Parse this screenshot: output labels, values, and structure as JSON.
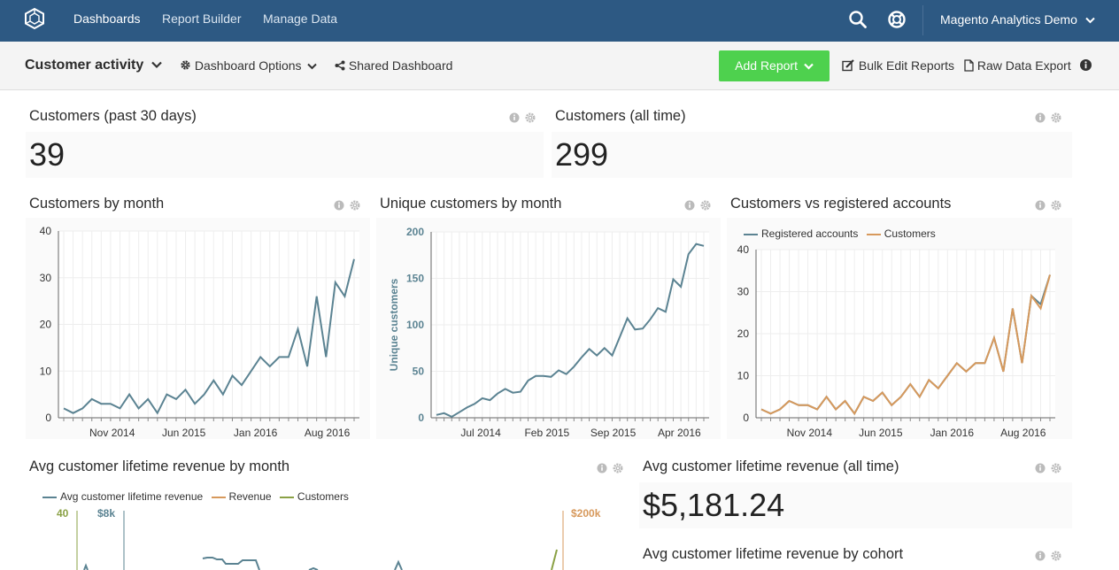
{
  "topnav": {
    "logo": "hexagon-logo-icon",
    "links": [
      "Dashboards",
      "Report Builder",
      "Manage Data"
    ],
    "account": "Magento Analytics Demo"
  },
  "toolbar": {
    "dashboard_name": "Customer activity",
    "dashboard_options": "Dashboard Options",
    "shared_dashboard": "Shared Dashboard",
    "add_report": "Add Report",
    "bulk_edit": "Bulk Edit Reports",
    "raw_export": "Raw Data Export"
  },
  "cards": {
    "c30": {
      "title": "Customers (past 30 days)",
      "value": "39"
    },
    "call": {
      "title": "Customers (all time)",
      "value": "299"
    },
    "cbm": {
      "title": "Customers by month"
    },
    "ucbm": {
      "title": "Unique customers by month"
    },
    "cvr": {
      "title": "Customers vs registered accounts"
    },
    "acltv": {
      "title": "Avg customer lifetime revenue by month"
    },
    "acltv_all": {
      "title": "Avg customer lifetime revenue (all time)",
      "value": "$5,181.24"
    },
    "acltv_cohort": {
      "title": "Avg customer lifetime revenue by cohort"
    }
  },
  "colors": {
    "nav": "#2d5983",
    "add_report": "#4ed14e",
    "series_blue": "#5b8392",
    "series_orange": "#d7995c",
    "series_green": "#8aa145"
  },
  "chart_data": [
    {
      "type": "line",
      "title": "Customers by month",
      "ylim": [
        0,
        40
      ],
      "yticks": [
        "0",
        "10",
        "20",
        "30",
        "40"
      ],
      "xticks": [
        "Nov 2014",
        "Jun 2015",
        "Jan 2016",
        "Aug 2016"
      ],
      "series": [
        {
          "values": [
            2,
            1,
            2,
            4,
            3,
            3,
            2,
            5,
            2,
            4,
            1,
            5,
            4,
            6,
            3,
            5,
            8,
            5,
            9,
            7,
            10,
            13,
            11,
            13,
            13,
            19,
            11,
            26,
            13,
            29,
            26,
            34
          ]
        }
      ],
      "grid": true
    },
    {
      "type": "line",
      "title": "Unique customers by month",
      "ylabel": "Unique customers",
      "ylim": [
        0,
        200
      ],
      "yticks": [
        "0",
        "50",
        "100",
        "150",
        "200"
      ],
      "xticks": [
        "Jul 2014",
        "Feb 2015",
        "Sep 2015",
        "Apr 2016"
      ],
      "series": [
        {
          "values": [
            3,
            5,
            1,
            6,
            11,
            15,
            21,
            19,
            26,
            31,
            27,
            28,
            40,
            45,
            45,
            44,
            51,
            47,
            55,
            65,
            74,
            67,
            75,
            67,
            87,
            107,
            95,
            96,
            106,
            118,
            114,
            149,
            141,
            176,
            187,
            185
          ]
        }
      ],
      "grid": true
    },
    {
      "type": "line",
      "title": "Customers vs registered accounts",
      "ylim": [
        0,
        40
      ],
      "yticks": [
        "0",
        "10",
        "20",
        "30",
        "40"
      ],
      "xticks": [
        "Nov 2014",
        "Jun 2015",
        "Jan 2016",
        "Aug 2016"
      ],
      "legend": "top-left",
      "series": [
        {
          "name": "Registered accounts",
          "values": [
            2,
            1,
            2,
            4,
            3,
            3,
            2,
            5,
            2,
            4,
            1,
            5,
            4,
            6,
            3,
            5,
            8,
            5,
            9,
            7,
            10,
            13,
            11,
            13,
            13,
            19,
            11,
            26,
            13,
            29,
            27,
            34
          ]
        },
        {
          "name": "Customers",
          "values": [
            2,
            1,
            2,
            4,
            3,
            3,
            2,
            5,
            2,
            4,
            1,
            5,
            4,
            6,
            3,
            5,
            8,
            5,
            9,
            7,
            10,
            13,
            11,
            13,
            13,
            19,
            11,
            26,
            13,
            29,
            26,
            34
          ]
        }
      ],
      "grid": true
    },
    {
      "type": "line",
      "title": "Avg customer lifetime revenue by month",
      "legend": "top-left",
      "axes_top_labels": {
        "left_outer": "40",
        "left_inner": "$8k",
        "right": "$200k"
      },
      "series": [
        {
          "name": "Avg customer lifetime revenue"
        },
        {
          "name": "Revenue"
        },
        {
          "name": "Customers"
        }
      ]
    }
  ]
}
